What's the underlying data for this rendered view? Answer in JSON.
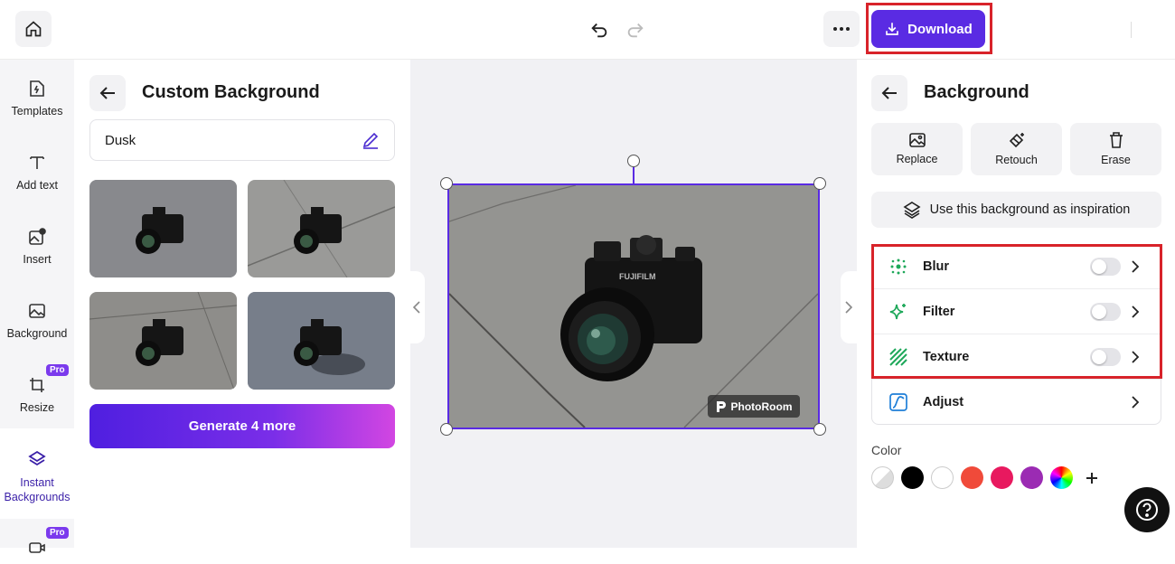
{
  "topbar": {
    "download_label": "Download"
  },
  "nav": {
    "items": [
      {
        "label": "Templates",
        "icon": "templates-icon"
      },
      {
        "label": "Add text",
        "icon": "text-icon"
      },
      {
        "label": "Insert",
        "icon": "insert-image-icon"
      },
      {
        "label": "Background",
        "icon": "background-icon"
      },
      {
        "label": "Resize",
        "icon": "crop-icon",
        "badge": "Pro"
      },
      {
        "label": "Instant Backgrounds",
        "icon": "layers-icon",
        "active": true
      },
      {
        "label": "",
        "icon": "video-icon",
        "badge": "Pro"
      }
    ]
  },
  "custom_bg": {
    "title": "Custom Background",
    "prompt_value": "Dusk",
    "thumbnails": [
      "Variation 1",
      "Variation 2",
      "Variation 3",
      "Variation 4"
    ],
    "generate_label": "Generate 4 more"
  },
  "canvas": {
    "watermark": "PhotoRoom",
    "camera_brand": "FUJIFILM"
  },
  "background_panel": {
    "title": "Background",
    "tools": [
      {
        "label": "Replace",
        "icon": "image-icon"
      },
      {
        "label": "Retouch",
        "icon": "eraser-sparkle-icon"
      },
      {
        "label": "Erase",
        "icon": "trash-icon"
      }
    ],
    "inspiration_label": "Use this background as inspiration",
    "options": [
      {
        "label": "Blur",
        "icon": "blur-icon",
        "toggle": false
      },
      {
        "label": "Filter",
        "icon": "sparkle-icon",
        "toggle": false
      },
      {
        "label": "Texture",
        "icon": "texture-icon",
        "toggle": false
      },
      {
        "label": "Adjust",
        "icon": "adjust-icon"
      }
    ],
    "color_label": "Color",
    "colors": [
      "#eeeeee",
      "#000000",
      "#ffffff",
      "#f04a3a",
      "#e8195f",
      "#9b2bb3"
    ]
  },
  "accent_color": "#5a2be3",
  "highlight_color": "#d8232a"
}
